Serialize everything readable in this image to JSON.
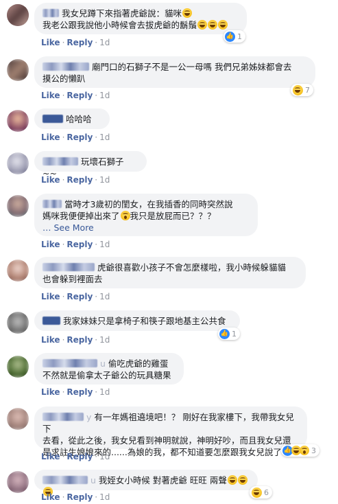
{
  "action_labels": {
    "like": "Like",
    "reply": "Reply",
    "dot": "·",
    "see_more": "… See More"
  },
  "comments": [
    {
      "name": "",
      "text": "我女兒蹲下來指著虎爺說：貓咪",
      "text2": "我老公跟我說他小時候會去拔虎爺的鬍鬚",
      "time": "1d",
      "reaction_count": "1"
    },
    {
      "name": "",
      "text": "廟門口的石獅子不是一公一母嗎 我們兄弟姊妹都會去",
      "text2": "摸公的懶趴",
      "time": "1d",
      "reaction_count": "7"
    },
    {
      "name": "",
      "text": "哈哈哈",
      "time": "1d"
    },
    {
      "name": "",
      "text": "玩壞石獅子 ~~",
      "time": "1d"
    },
    {
      "name": "",
      "text": "當時才3歲初的閨女，在我插香的同時突然說",
      "text2": "媽咪我便便掉出來了",
      "text3": "我只是放屁而已？？？",
      "time": "1d"
    },
    {
      "name": "",
      "text": "虎爺很喜歡小孩子不會怎麼樣啦，我小時候躲貓貓",
      "text2": "也會躲到裡面去",
      "time": "1d"
    },
    {
      "name": "",
      "text": "我家妹妹只是拿椅子和筷子跟地基主公共食",
      "time": "1d",
      "reaction_count": "1"
    },
    {
      "name": "",
      "text": "偷吃虎爺的雞蛋",
      "name_suffix": "u",
      "text2": "不然就是偷拿太子爺公的玩具糖果",
      "time": "1d"
    },
    {
      "name": "",
      "name_suffix": "y",
      "text": "有一年媽祖遶境吧！？ 剛好在我家樓下，我帶我女兒下",
      "text2": "去看，從此之後，我女兒看到神明就說，神明好吵，而且我女兒還",
      "text3": "是求註生娘娘來的......為娘的我，都不知道要怎麼跟我女兒說了",
      "time": "1d",
      "reaction_count": "3"
    },
    {
      "name": "",
      "name_suffix": "u",
      "text": "我姪女小時候 對著虎爺 旺旺 兩聲",
      "time": "1d",
      "reaction_count": "6"
    }
  ],
  "icons": {
    "like": "like-icon",
    "haha": "haha-emoji",
    "wow": "wow-emoji"
  },
  "colors": {
    "link": "#4b67a1",
    "bubble": "#f2f3f5",
    "like_blue": "#2d88ff"
  }
}
